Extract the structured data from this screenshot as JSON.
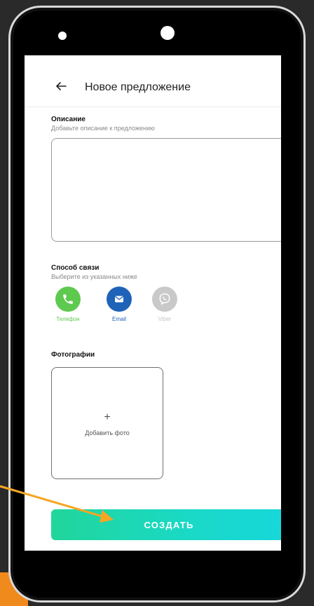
{
  "header": {
    "title": "Новое предложение"
  },
  "description": {
    "title": "Описание",
    "subtitle": "Добавьте описание к предложению",
    "value": ""
  },
  "contact": {
    "title": "Способ связи",
    "subtitle": "Выберите из указанных ниже",
    "options": [
      {
        "label": "Телефон",
        "icon": "phone-icon",
        "color": "#5ec94f",
        "selected": true
      },
      {
        "label": "Email",
        "icon": "email-icon",
        "color": "#1f63b8",
        "selected": true
      },
      {
        "label": "Viber",
        "icon": "viber-icon",
        "color": "#c9c9c9",
        "selected": false
      }
    ]
  },
  "photos": {
    "title": "Фотографии",
    "add_symbol": "+",
    "add_label": "Добавить фото"
  },
  "actions": {
    "create_label": "СОЗДАТЬ"
  },
  "colors": {
    "accent_gradient_start": "#20d69b",
    "accent_gradient_end": "#17d7db",
    "annotation_arrow": "#f5a623"
  }
}
